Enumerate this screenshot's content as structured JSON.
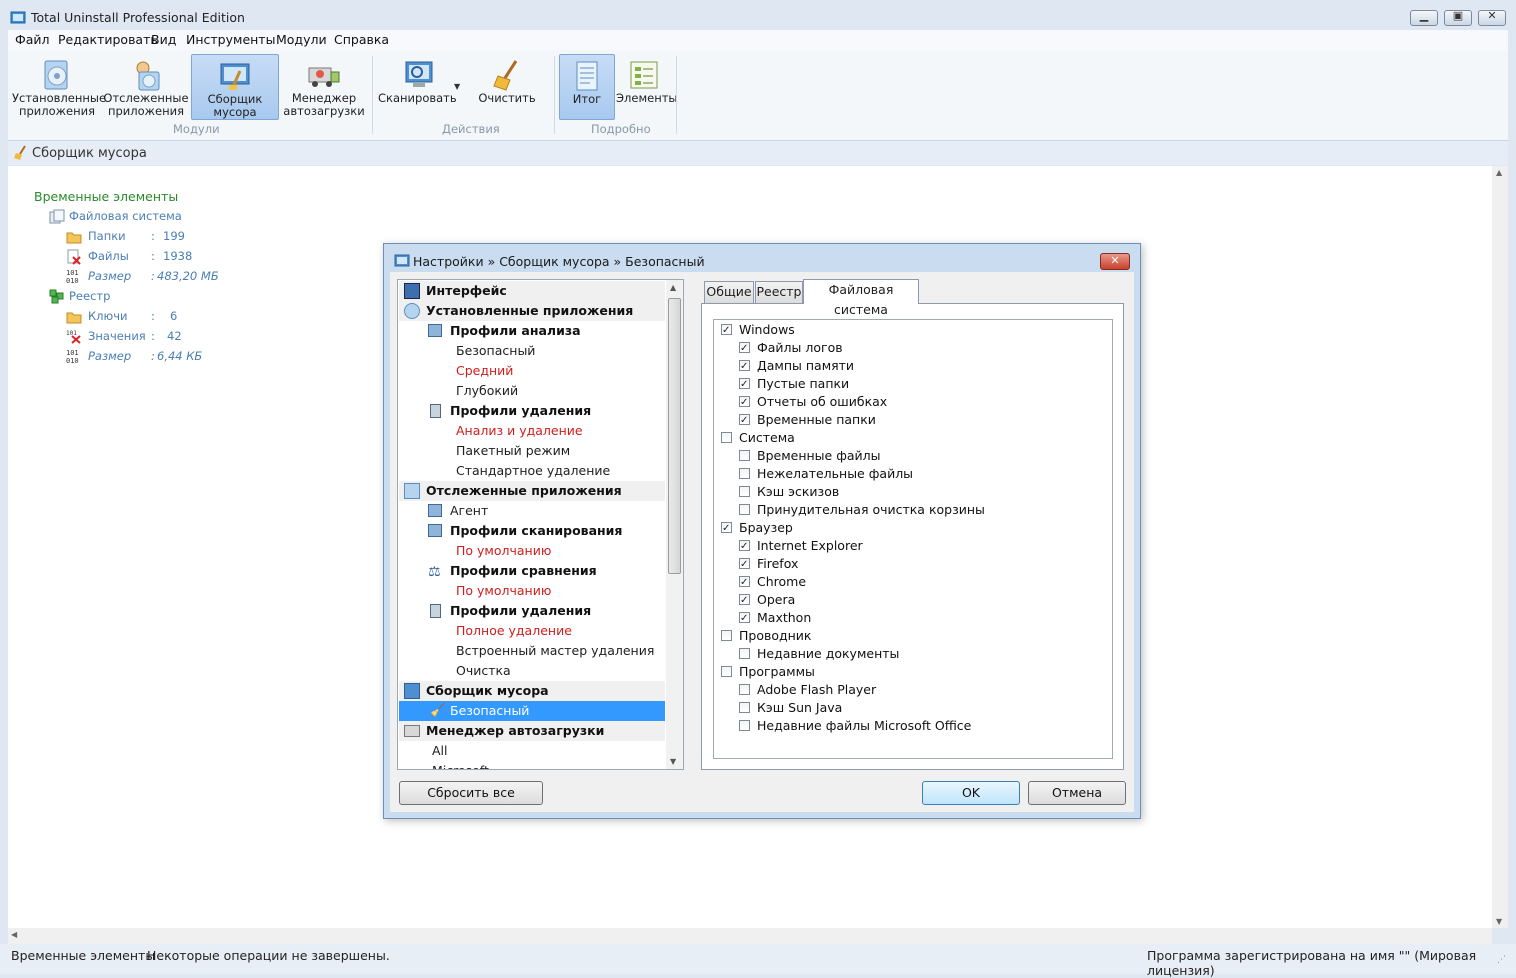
{
  "window": {
    "title": "Total Uninstall Professional Edition"
  },
  "menu": [
    "Файл",
    "Редактировать",
    "Вид",
    "Инструменты",
    "Модули",
    "Справка"
  ],
  "ribbon": {
    "installed": "Установленные приложения",
    "installed_l1": "Установленные",
    "installed_l2": "приложения",
    "tracked_l1": "Отслеженные",
    "tracked_l2": "приложения",
    "junk_l1": "Сборщик",
    "junk_l2": "мусора",
    "startup_l1": "Менеджер",
    "startup_l2": "автозагрузки",
    "scan": "Сканировать",
    "clean": "Очистить",
    "summary": "Итог",
    "elements": "Элементы",
    "group_modules": "Модули",
    "group_actions": "Действия",
    "group_details": "Подробно"
  },
  "breadcrumb": "Сборщик мусора",
  "results": {
    "root": "Временные элементы",
    "fs": "Файловая система",
    "folders_label": "Папки",
    "folders_value": "199",
    "files_label": "Файлы",
    "files_value": "1938",
    "size1_label": "Размер",
    "size1_value": "483,20 МБ",
    "registry": "Реестр",
    "keys_label": "Ключи",
    "keys_value": "6",
    "values_label": "Значения",
    "values_value": "42",
    "size2_label": "Размер",
    "size2_value": "6,44 КБ",
    "colon": ":"
  },
  "dialog": {
    "title": "Настройки » Сборщик мусора » Безопасный",
    "tree": [
      "Интерфейс",
      "Установленные приложения",
      "Профили анализа",
      "Безопасный",
      "Средний",
      "Глубокий",
      "Профили удаления",
      "Анализ и удаление",
      "Пакетный режим",
      "Стандартное удаление",
      "Отслеженные приложения",
      "Агент",
      "Профили сканирования",
      "По умолчанию",
      "Профили сравнения",
      "По умолчанию",
      "Профили удаления",
      "Полное удаление",
      "Встроенный мастер удаления",
      "Очистка",
      "Сборщик мусора",
      "Безопасный",
      "Менеджер автозагрузки",
      "All",
      "Microsoft"
    ],
    "tabs": [
      "Общие",
      "Реестр",
      "Файловая система"
    ],
    "checks": [
      {
        "label": "Windows",
        "checked": true
      },
      {
        "label": "Файлы логов",
        "checked": true
      },
      {
        "label": "Дампы памяти",
        "checked": true
      },
      {
        "label": "Пустые папки",
        "checked": true
      },
      {
        "label": "Отчеты об ошибках",
        "checked": true
      },
      {
        "label": "Временные папки",
        "checked": true
      },
      {
        "label": "Система",
        "checked": false
      },
      {
        "label": "Временные файлы",
        "checked": false
      },
      {
        "label": "Нежелательные файлы",
        "checked": false
      },
      {
        "label": "Кэш эскизов",
        "checked": false
      },
      {
        "label": "Принудительная очистка корзины",
        "checked": false
      },
      {
        "label": "Браузер",
        "checked": true
      },
      {
        "label": "Internet Explorer",
        "checked": true
      },
      {
        "label": "Firefox",
        "checked": true
      },
      {
        "label": "Chrome",
        "checked": true
      },
      {
        "label": "Opera",
        "checked": true
      },
      {
        "label": "Maxthon",
        "checked": true
      },
      {
        "label": "Проводник",
        "checked": false
      },
      {
        "label": "Недавние документы",
        "checked": false
      },
      {
        "label": "Программы",
        "checked": false
      },
      {
        "label": "Adobe Flash Player",
        "checked": false
      },
      {
        "label": "Кэш Sun Java",
        "checked": false
      },
      {
        "label": "Недавние файлы Microsoft Office",
        "checked": false
      }
    ],
    "reset_all": "Сбросить все",
    "ok": "OK",
    "cancel": "Отмена"
  },
  "status": {
    "left": "Временные элементы",
    "middle": "Некоторые операции не завершены.",
    "right": "Программа зарегистрирована на имя \"\" (Мировая лицензия)"
  }
}
